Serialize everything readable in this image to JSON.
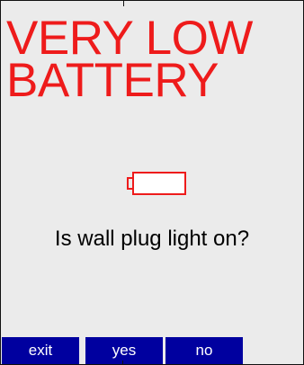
{
  "screen": {
    "title_line1": "VERY LOW",
    "title_line2": "BATTERY",
    "question": "Is wall plug light on?",
    "icon": "battery-low-icon"
  },
  "softkeys": {
    "exit": "exit",
    "yes": "yes",
    "no": "no"
  },
  "colors": {
    "title": "#ee1b1b",
    "softkey_bg": "#00009f",
    "screen_bg": "#ebebeb"
  }
}
